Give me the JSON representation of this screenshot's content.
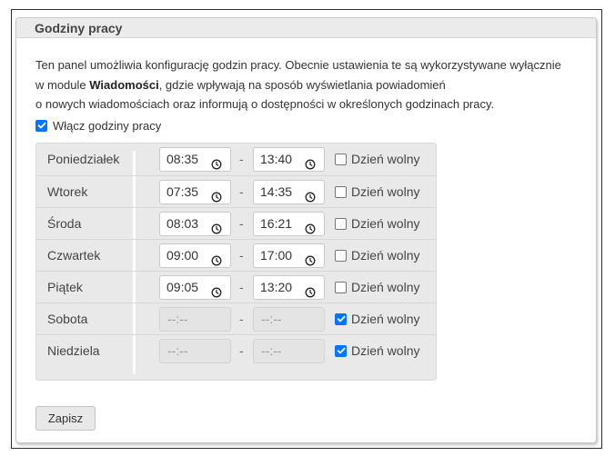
{
  "panel": {
    "title": "Godziny pracy",
    "description_line1": "Ten panel umożliwia konfigurację godzin pracy. Obecnie ustawienia te są wykorzystywane wyłącznie",
    "description_line2_before": "w module ",
    "description_line2_bold": "Wiadomości",
    "description_line2_after": ", gdzie wpływają na sposób wyświetlania powiadomień",
    "description_line3": "o nowych wiadomościach oraz informują o dostępności w określonych godzinach pracy.",
    "enable_label": "Włącz godziny pracy",
    "enable_checked": true
  },
  "days": [
    {
      "name": "Poniedziałek",
      "start": "08:35",
      "end": "13:40",
      "day_off": false
    },
    {
      "name": "Wtorek",
      "start": "07:35",
      "end": "14:35",
      "day_off": false
    },
    {
      "name": "Środa",
      "start": "08:03",
      "end": "16:21",
      "day_off": false
    },
    {
      "name": "Czwartek",
      "start": "09:00",
      "end": "17:00",
      "day_off": false
    },
    {
      "name": "Piątek",
      "start": "09:05",
      "end": "13:20",
      "day_off": false
    },
    {
      "name": "Sobota",
      "start": "--:--",
      "end": "--:--",
      "day_off": true
    },
    {
      "name": "Niedziela",
      "start": "--:--",
      "end": "--:--",
      "day_off": true
    }
  ],
  "separator": "-",
  "day_off_label": "Dzień wolny",
  "save_label": "Zapisz",
  "icons": {
    "time": "clock-icon",
    "check": "checkmark-icon"
  },
  "colors": {
    "accent": "#0075ff",
    "header_bg": "#ebebeb",
    "table_bg": "#e9e9e9"
  }
}
